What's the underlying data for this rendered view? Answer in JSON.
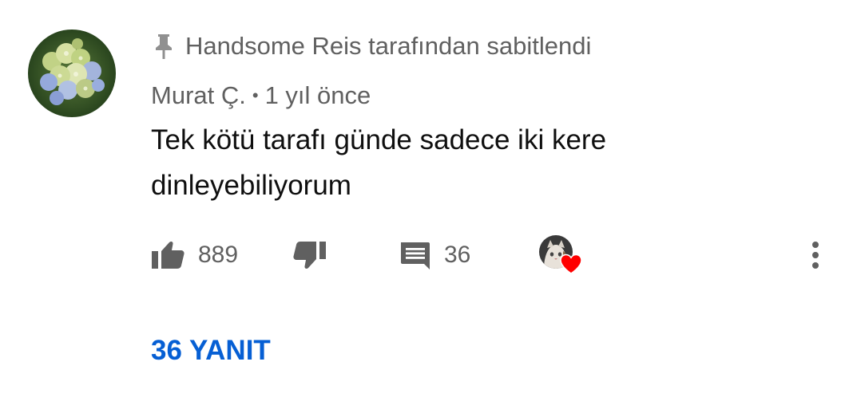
{
  "comment": {
    "pinned_text": "Handsome Reis tarafından sabitlendi",
    "author": "Murat Ç.",
    "separator": "•",
    "time_ago": "1 yıl önce",
    "text": "Tek kötü tarafı günde sadece iki kere dinleyebiliyorum",
    "avatar_icon": "hydrangea-flower-avatar",
    "likes": "889",
    "replies_count": "36"
  },
  "actions": {
    "like_icon": "thumb-up-icon",
    "dislike_icon": "thumb-down-icon",
    "reply_icon": "comment-icon",
    "creator_heart_icon": "creator-heart-icon",
    "menu_icon": "more-vertical-icon"
  },
  "replies": {
    "label": "36 YANIT"
  },
  "colors": {
    "secondary_text": "#606060",
    "primary_text": "#0f0f0f",
    "link_blue": "#065fd4",
    "heart_red": "#ff0000"
  }
}
